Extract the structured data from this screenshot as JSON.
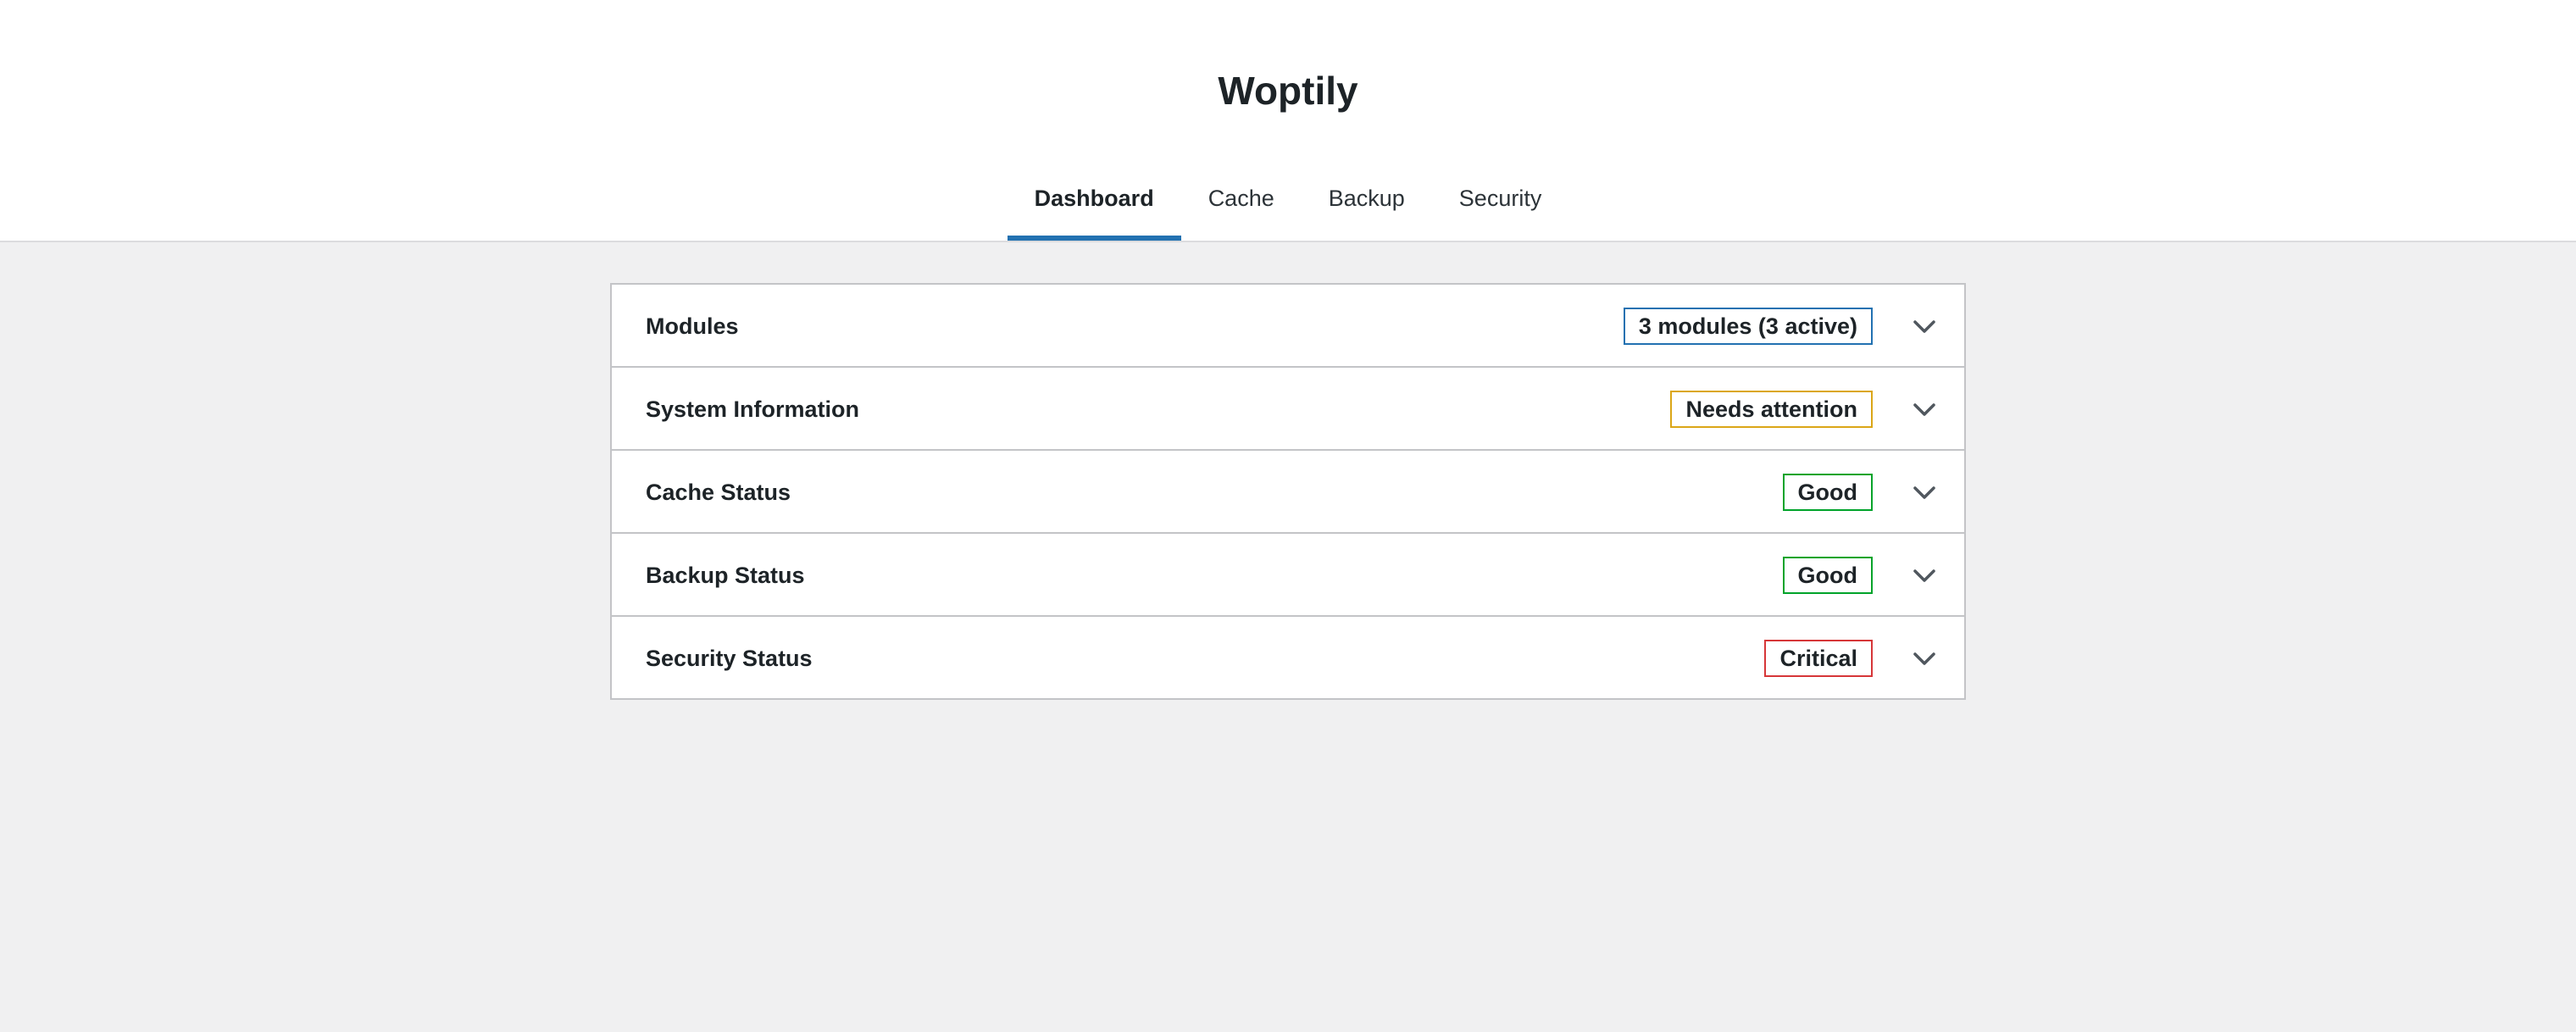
{
  "app": {
    "title": "Woptily"
  },
  "tabs": [
    {
      "label": "Dashboard",
      "active": true
    },
    {
      "label": "Cache",
      "active": false
    },
    {
      "label": "Backup",
      "active": false
    },
    {
      "label": "Security",
      "active": false
    }
  ],
  "accent_color": "#2271b1",
  "status_colors": {
    "info": "#2271b1",
    "warning": "#dba617",
    "good": "#00a32a",
    "critical": "#d63638"
  },
  "sections": [
    {
      "label": "Modules",
      "badge": "3 modules (3 active)",
      "status": "info",
      "icon": "chevron-down-icon"
    },
    {
      "label": "System Information",
      "badge": "Needs attention",
      "status": "warning",
      "icon": "chevron-down-icon"
    },
    {
      "label": "Cache Status",
      "badge": "Good",
      "status": "good",
      "icon": "chevron-down-icon"
    },
    {
      "label": "Backup Status",
      "badge": "Good",
      "status": "good",
      "icon": "chevron-down-icon"
    },
    {
      "label": "Security Status",
      "badge": "Critical",
      "status": "critical",
      "icon": "chevron-down-icon"
    }
  ]
}
